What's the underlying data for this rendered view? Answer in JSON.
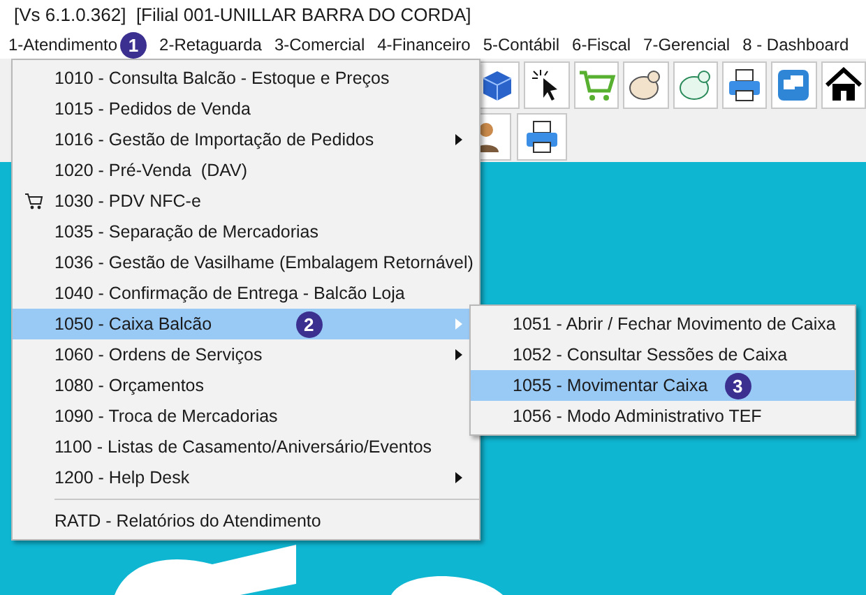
{
  "window": {
    "title": "[Vs 6.1.0.362]  [Filial 001-UNILLAR BARRA DO CORDA]"
  },
  "menubar": [
    {
      "label": "1-Atendimento",
      "badge": "1"
    },
    {
      "label": "2-Retaguarda"
    },
    {
      "label": "3-Comercial"
    },
    {
      "label": "4-Financeiro"
    },
    {
      "label": "5-Contábil"
    },
    {
      "label": "6-Fiscal"
    },
    {
      "label": "7-Gerencial"
    },
    {
      "label": "8 - Dashboard"
    }
  ],
  "menu": [
    {
      "kind": "item",
      "label": "1010 - Consulta Balcão - Estoque e Preços",
      "submenu": false,
      "selected": false
    },
    {
      "kind": "item",
      "label": "1015 - Pedidos de Venda",
      "submenu": false,
      "selected": false
    },
    {
      "kind": "item",
      "label": "1016 - Gestão de Importação de Pedidos",
      "submenu": true,
      "selected": false
    },
    {
      "kind": "item",
      "label": "1020 - Pré-Venda  (DAV)",
      "submenu": false,
      "selected": false
    },
    {
      "kind": "cart_item",
      "label": "1030 - PDV NFC-e",
      "submenu": false,
      "selected": false
    },
    {
      "kind": "item",
      "label": "1035 - Separação de Mercadorias",
      "submenu": false,
      "selected": false
    },
    {
      "kind": "item",
      "label": "1036 - Gestão de Vasilhame (Embalagem Retornável)",
      "submenu": false,
      "selected": false
    },
    {
      "kind": "item",
      "label": "1040 - Confirmação de Entrega - Balcão Loja",
      "submenu": false,
      "selected": false
    },
    {
      "kind": "item",
      "label": "1050 - Caixa Balcão",
      "submenu": true,
      "selected": true,
      "badge": "2"
    },
    {
      "kind": "item",
      "label": "1060 - Ordens de Serviços",
      "submenu": true,
      "selected": false
    },
    {
      "kind": "item",
      "label": "1080 - Orçamentos",
      "submenu": false,
      "selected": false
    },
    {
      "kind": "item",
      "label": "1090 - Troca de Mercadorias",
      "submenu": false,
      "selected": false
    },
    {
      "kind": "item",
      "label": "1100 - Listas de Casamento/Aniversário/Eventos",
      "submenu": false,
      "selected": false
    },
    {
      "kind": "item",
      "label": "1200 - Help Desk",
      "submenu": true,
      "selected": false
    },
    {
      "kind": "separator"
    },
    {
      "kind": "item",
      "label": "RATD - Relatórios do Atendimento",
      "submenu": false,
      "selected": false
    }
  ],
  "submenu": [
    {
      "label": "1051 - Abrir / Fechar Movimento de Caixa",
      "selected": false
    },
    {
      "label": "1052 - Consultar Sessões de Caixa",
      "selected": false
    },
    {
      "label": "1055 - Movimentar Caixa",
      "selected": true,
      "badge": "3"
    },
    {
      "label": "1056 - Modo Administrativo TEF",
      "selected": false
    }
  ]
}
